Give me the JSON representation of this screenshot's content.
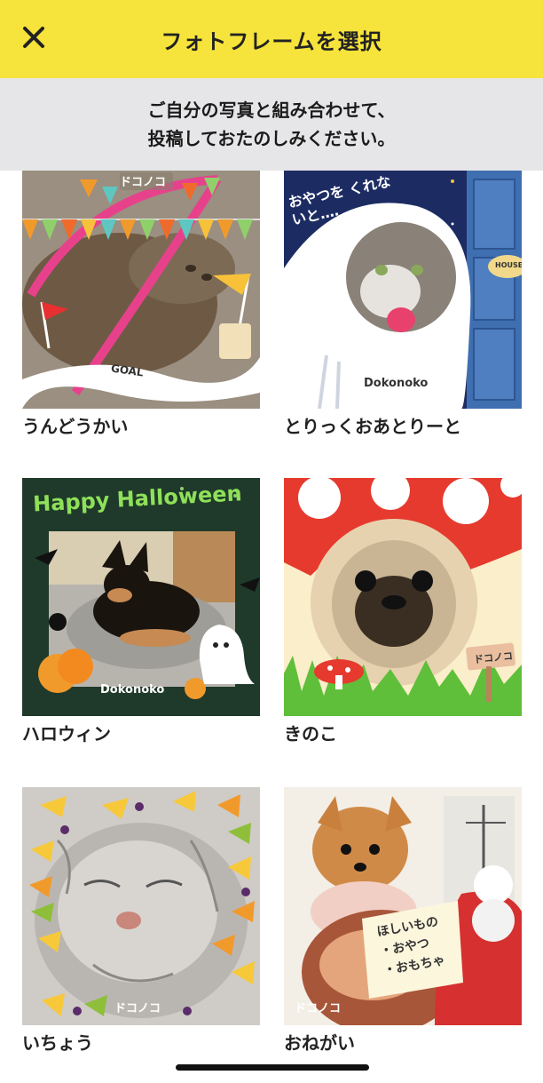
{
  "header": {
    "title": "フォトフレームを選択",
    "close_icon": "close-icon"
  },
  "subheader": {
    "line1": "ご自分の写真と組み合わせて、",
    "line2": "投稿しておたのしみください。"
  },
  "frames": [
    {
      "label": "うんどうかい",
      "tag": "ドコノコ",
      "banner": "GOAL"
    },
    {
      "label": "とりっくおあとりーと",
      "caption": "おやつを くれないと‥‥",
      "house": "HOUSE",
      "tag": "Dokonoko"
    },
    {
      "label": "ハロウィン",
      "headline": "Happy Halloween",
      "tag": "Dokonoko"
    },
    {
      "label": "きのこ",
      "tag": "ドコノコ"
    },
    {
      "label": "いちょう",
      "tag": "ドコノコ"
    },
    {
      "label": "おねがい",
      "tag": "ドコノコ",
      "note_line1": "ほしいもの",
      "note_line2": "・おやつ",
      "note_line3": "・おもちゃ"
    }
  ],
  "colors": {
    "header_bg": "#f6e33b",
    "subheader_bg": "#e6e6e8"
  }
}
